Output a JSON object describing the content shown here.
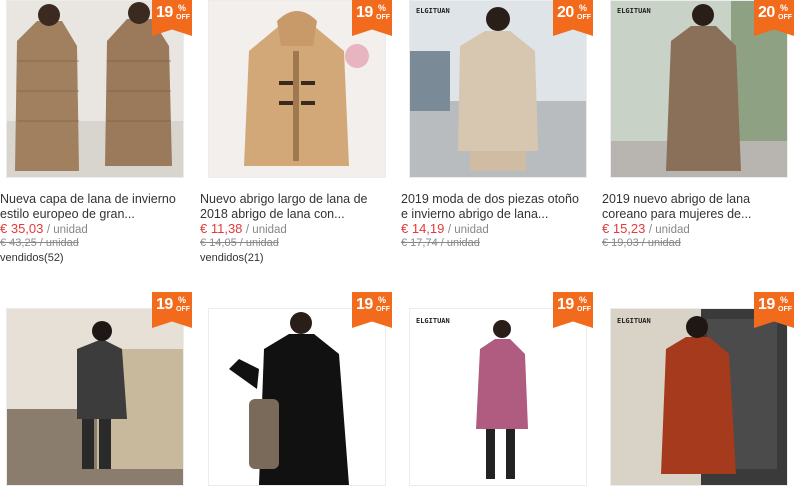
{
  "products": [
    {
      "badge": {
        "value": "19",
        "percent": "%",
        "off": "OFF"
      },
      "title": "Nueva capa de lana de invierno estilo europeo de gran...",
      "price": "€ 35,03",
      "unit": "/ unidad",
      "old_price": "€ 43,25 / unidad",
      "sold": "vendidos(52)"
    },
    {
      "badge": {
        "value": "19",
        "percent": "%",
        "off": "OFF"
      },
      "title": "Nuevo abrigo largo de lana de 2018 abrigo de lana con...",
      "price": "€ 11,38",
      "unit": "/ unidad",
      "old_price": "€ 14,05 / unidad",
      "sold": "vendidos(21)"
    },
    {
      "badge": {
        "value": "20",
        "percent": "%",
        "off": "OFF"
      },
      "title": "2019 moda de dos piezas otoño e invierno abrigo de lana...",
      "price": "€ 14,19",
      "unit": "/ unidad",
      "old_price": "€ 17,74 / unidad",
      "brand": "ELGITUAN"
    },
    {
      "badge": {
        "value": "20",
        "percent": "%",
        "off": "OFF"
      },
      "title": "2019 nuevo abrigo de lana coreano para mujeres de...",
      "price": "€ 15,23",
      "unit": "/ unidad",
      "old_price": "€ 19,03 / unidad",
      "brand": "ELGITUAN"
    },
    {
      "badge": {
        "value": "19",
        "percent": "%",
        "off": "OFF"
      }
    },
    {
      "badge": {
        "value": "19",
        "percent": "%",
        "off": "OFF"
      }
    },
    {
      "badge": {
        "value": "19",
        "percent": "%",
        "off": "OFF"
      },
      "brand": "ELGITUAN"
    },
    {
      "badge": {
        "value": "19",
        "percent": "%",
        "off": "OFF"
      },
      "brand": "ELGITUAN"
    }
  ],
  "colors": {
    "badge": "#f26a1b",
    "price": "#e4393c",
    "muted": "#888888"
  }
}
